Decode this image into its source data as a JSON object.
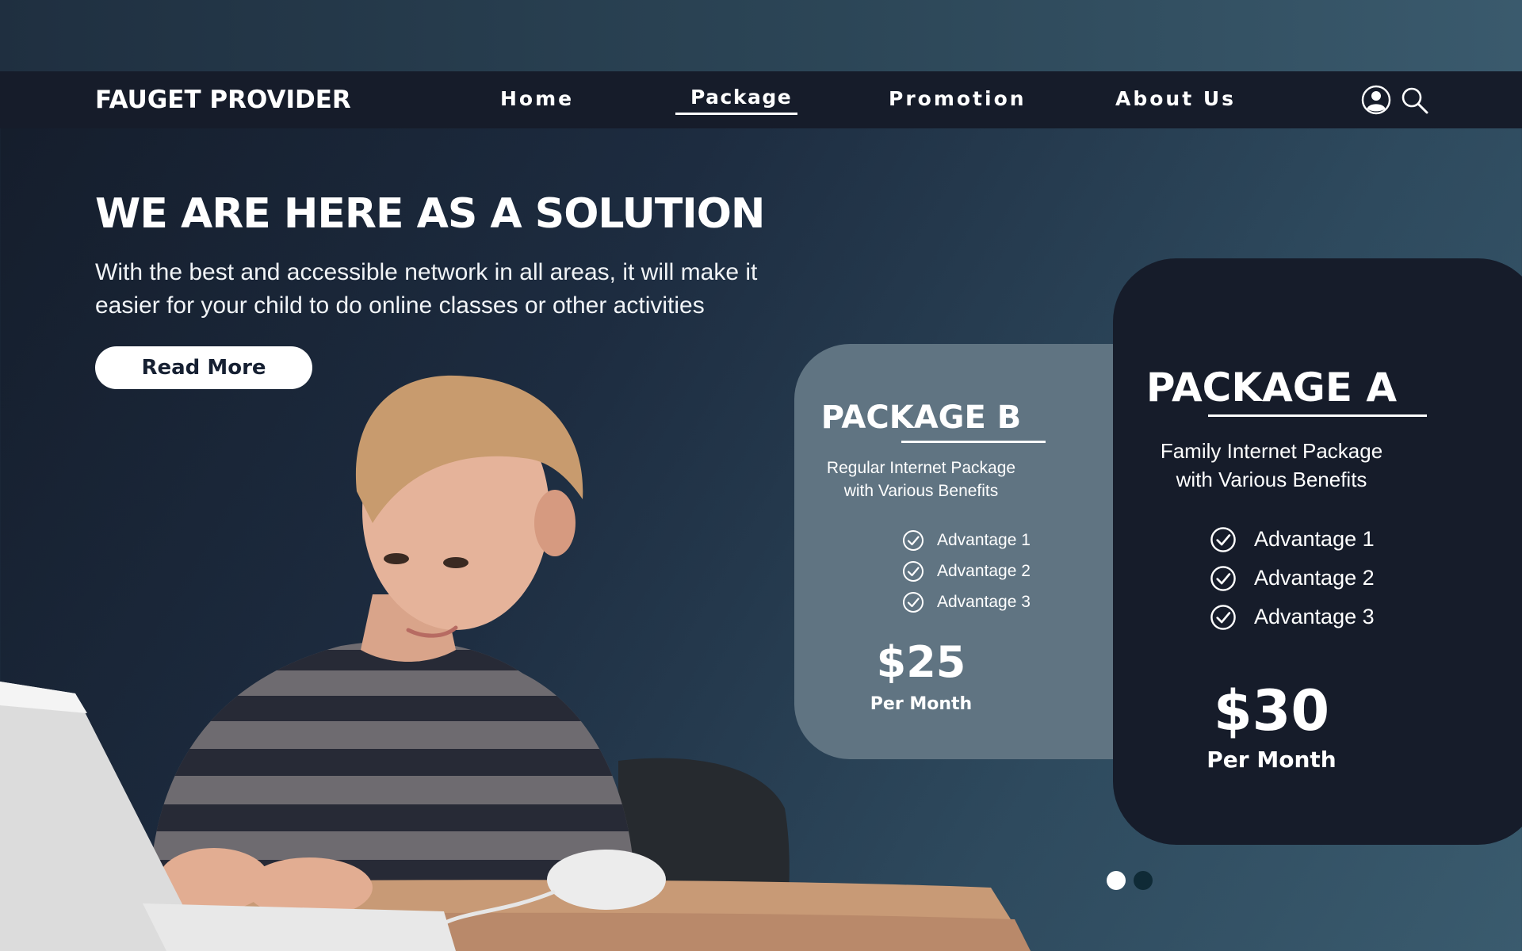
{
  "nav": {
    "brand": "FAUGET PROVIDER",
    "links": [
      {
        "label": "Home",
        "active": false
      },
      {
        "label": "Package",
        "active": true
      },
      {
        "label": "Promotion",
        "active": false
      },
      {
        "label": "About Us",
        "active": false
      }
    ],
    "icons": [
      "user-icon",
      "search-icon"
    ]
  },
  "hero": {
    "title": "WE ARE HERE AS A SOLUTION",
    "text": "With the best and accessible network in all areas, it will make it easier for your child to do online classes or other activities",
    "button": "Read More",
    "image": "boy-using-laptop-photo"
  },
  "packages": [
    {
      "title": "PACKAGE B",
      "subtitle_line1": "Regular Internet Package",
      "subtitle_line2": "with Various Benefits",
      "advantages": [
        "Advantage 1",
        "Advantage 2",
        "Advantage 3"
      ],
      "price": "$25",
      "period": "Per Month"
    },
    {
      "title": "PACKAGE A",
      "subtitle_line1": "Family Internet Package",
      "subtitle_line2": "with Various Benefits",
      "advantages": [
        "Advantage 1",
        "Advantage 2",
        "Advantage 3"
      ],
      "price": "$30",
      "period": "Per Month"
    }
  ],
  "pagination": {
    "pages": 2,
    "current": 1
  },
  "colors": {
    "nav_bg": "#161c2a",
    "card_a_bg": "#161c2a",
    "card_b_bg": "#607482",
    "accent_text": "#ffffff",
    "button_text": "#162032"
  }
}
